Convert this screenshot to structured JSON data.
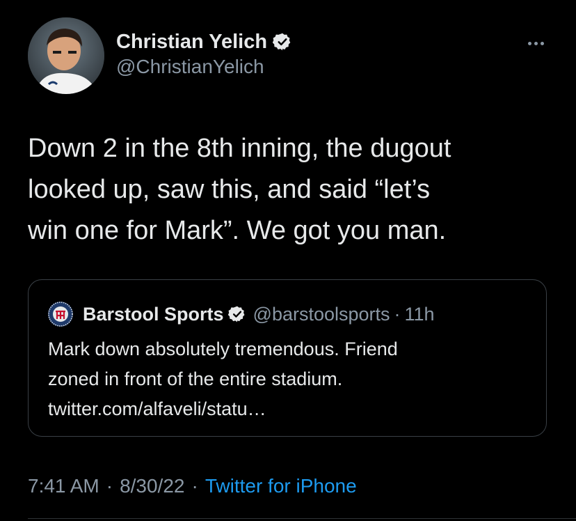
{
  "author": {
    "display_name": "Christian Yelich",
    "handle": "@ChristianYelich",
    "verified_icon": "verified-badge-icon",
    "verified_color": "#e7e9ea"
  },
  "tweet": {
    "lines": [
      "Down 2 in the 8th inning, the dugout",
      "looked up, saw this, and said “let’s",
      "win one for Mark”. We got you man."
    ]
  },
  "quote": {
    "display_name": "Barstool Sports",
    "handle": "@barstoolsports",
    "separator": "·",
    "time": "11h",
    "avatar_icon": "barstool-logo-icon",
    "lines": [
      "Mark down absolutely tremendous. Friend",
      "zoned in front of the entire stadium.",
      "twitter.com/alfaveli/statu…"
    ]
  },
  "meta": {
    "time": "7:41 AM",
    "separator": "·",
    "date": "8/30/22",
    "source": "Twitter for iPhone"
  },
  "menu": {
    "icon": "more-options-icon"
  },
  "colors": {
    "background": "#000000",
    "text": "#e7e9ea",
    "muted": "#8b98a5",
    "link": "#1d9bf0",
    "border": "#3a4046"
  }
}
